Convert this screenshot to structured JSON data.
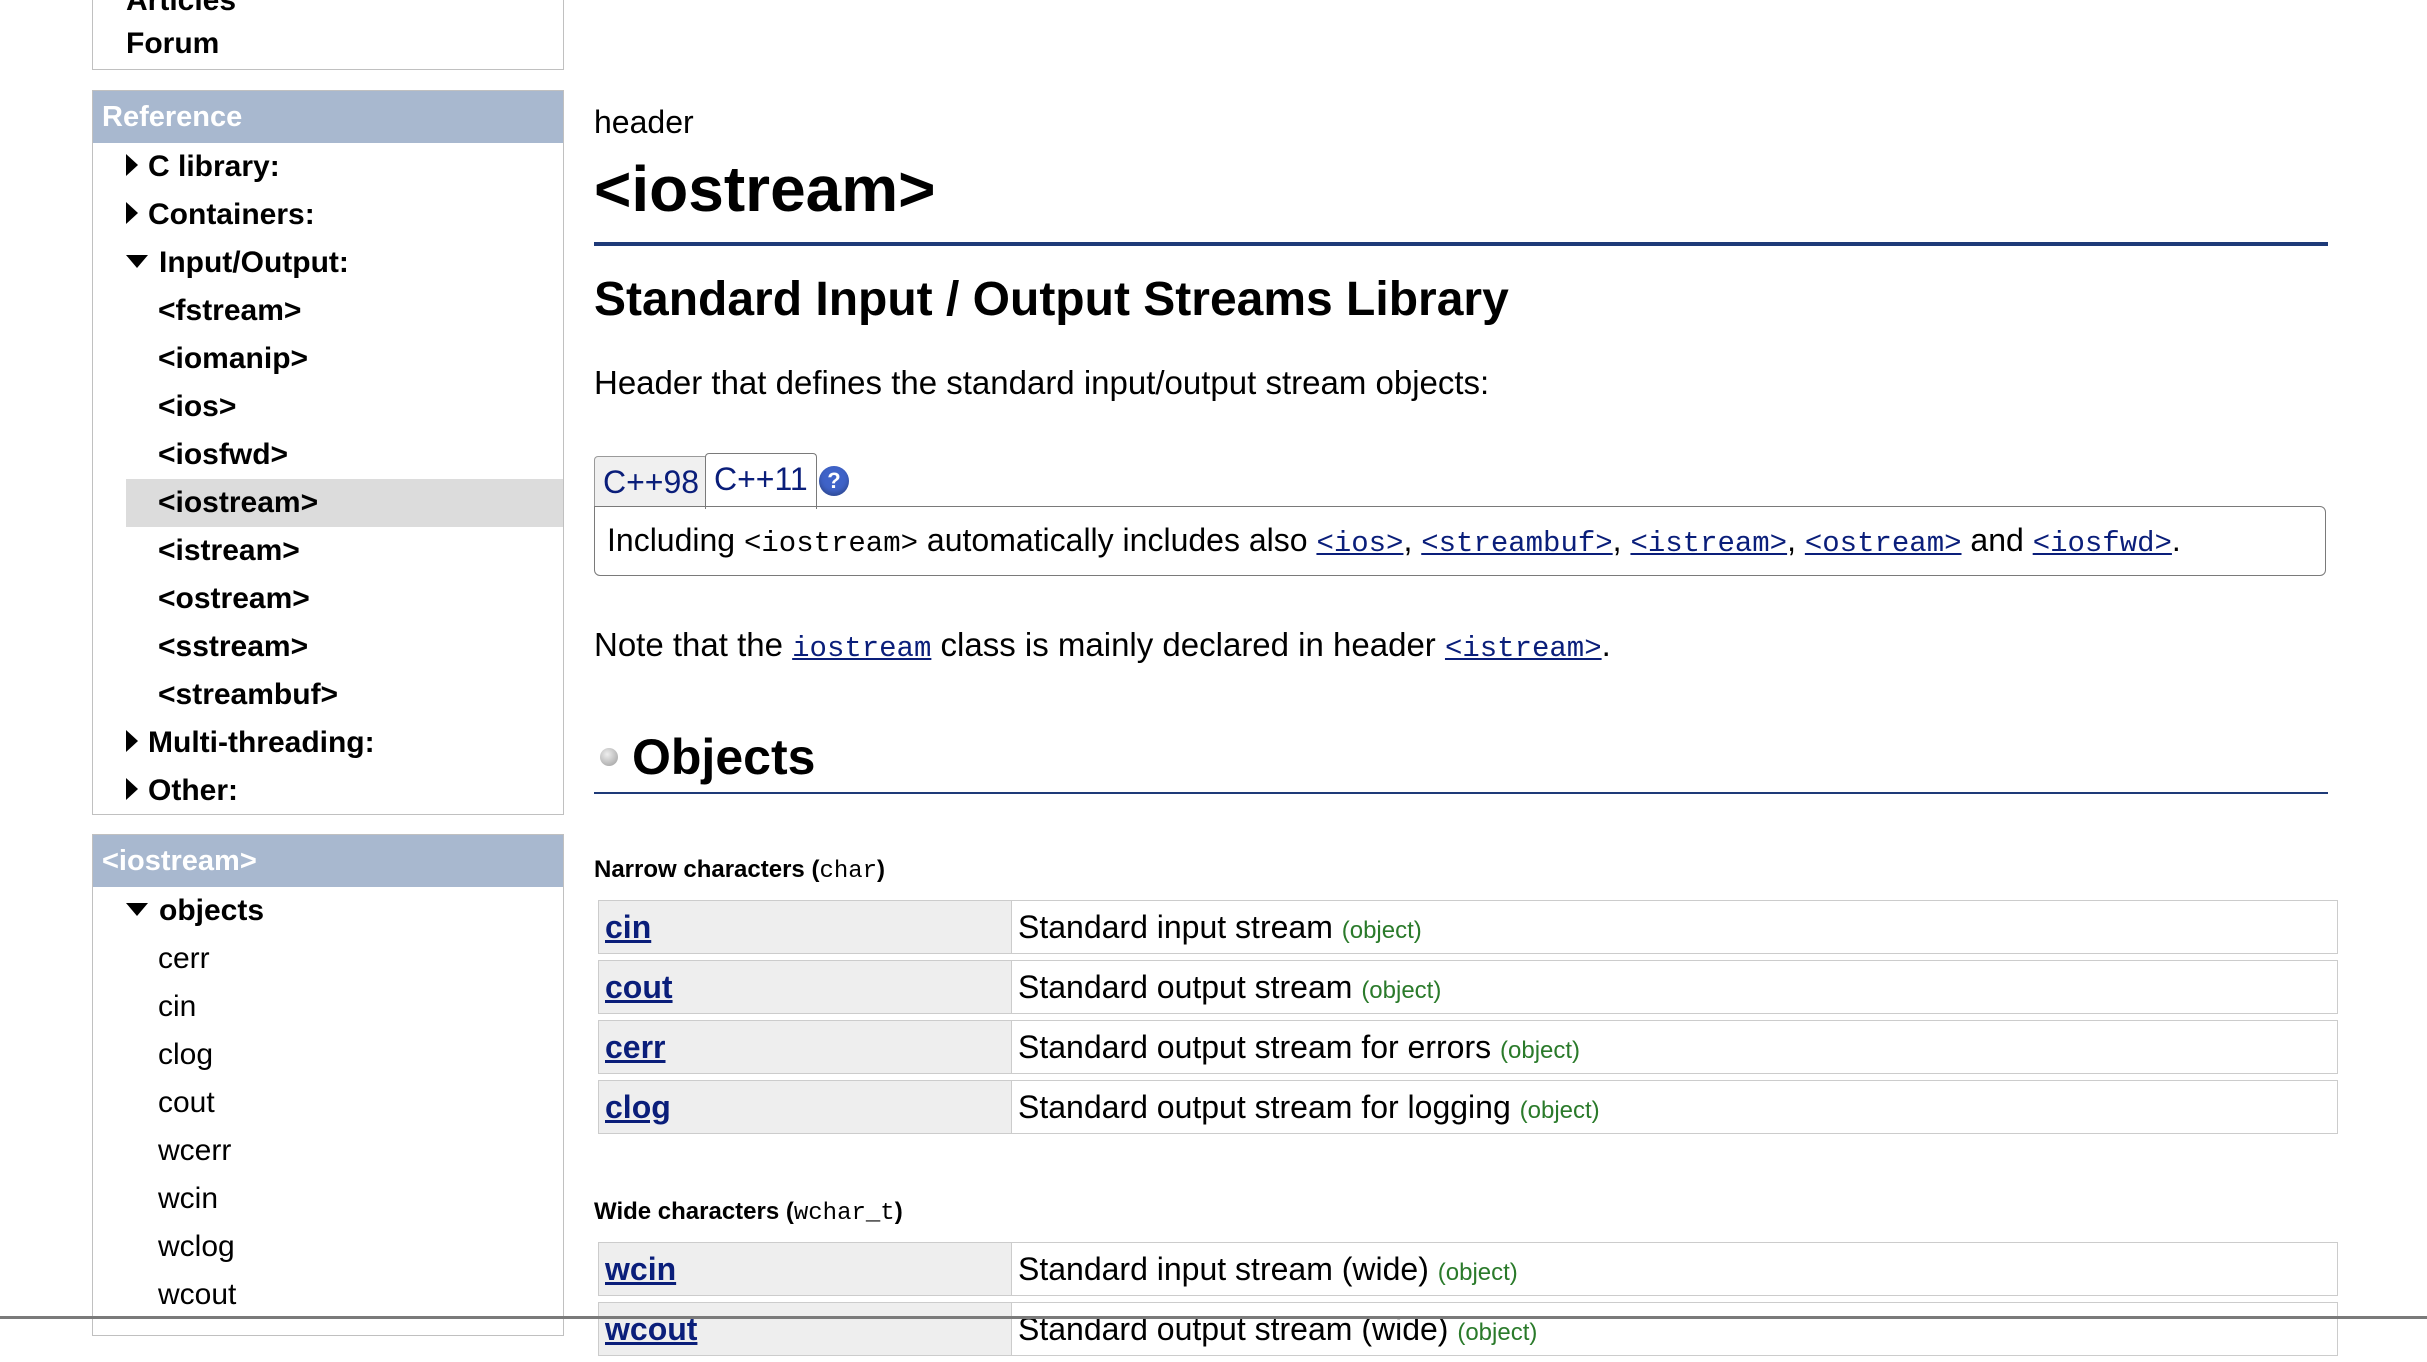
{
  "sidebar": {
    "top_box": {
      "items": [
        "Articles",
        "Forum"
      ]
    },
    "reference": {
      "heading": "Reference",
      "c_library": "C library:",
      "containers": "Containers:",
      "input_output": "Input/Output:",
      "io_items": [
        "<fstream>",
        "<iomanip>",
        "<ios>",
        "<iosfwd>",
        "<iostream>",
        "<istream>",
        "<ostream>",
        "<sstream>",
        "<streambuf>"
      ],
      "selected": "<iostream>",
      "multithreading": "Multi-threading:",
      "other": "Other:"
    },
    "iostream": {
      "heading": "<iostream>",
      "objects_label": "objects",
      "objects": [
        "cerr",
        "cin",
        "clog",
        "cout",
        "wcerr",
        "wcin",
        "wclog",
        "wcout"
      ]
    }
  },
  "main": {
    "kind": "header",
    "title": "<iostream>",
    "subtitle": "Standard Input / Output Streams Library",
    "description": "Header that defines the standard input/output stream objects:",
    "tabs": [
      "C++98",
      "C++11"
    ],
    "active_tab": "C++11",
    "help_icon": "?",
    "version_note": {
      "prefix": "Including ",
      "code": "<iostream>",
      "middle": " automatically includes also ",
      "links": [
        "<ios>",
        "<streambuf>",
        "<istream>",
        "<ostream>"
      ],
      "and": " and ",
      "last_link": "<iosfwd>",
      "end": "."
    },
    "note": {
      "prefix": "Note that the ",
      "link1": "iostream",
      "middle": " class is mainly declared in header ",
      "link2": "<istream>",
      "end": "."
    },
    "objects_heading": "Objects",
    "narrow": {
      "label": "Narrow characters (",
      "type": "char",
      "close": ")",
      "rows": [
        {
          "name": "cin",
          "desc": "Standard input stream",
          "tag": "(object)"
        },
        {
          "name": "cout",
          "desc": "Standard output stream",
          "tag": "(object)"
        },
        {
          "name": "cerr",
          "desc": "Standard output stream for errors",
          "tag": "(object)"
        },
        {
          "name": "clog",
          "desc": "Standard output stream for logging",
          "tag": "(object)"
        }
      ]
    },
    "wide": {
      "label": "Wide characters (",
      "type": "wchar_t",
      "close": ")",
      "rows": [
        {
          "name": "wcin",
          "desc": "Standard input stream (wide)",
          "tag": "(object)"
        },
        {
          "name": "wcout",
          "desc": "Standard output stream (wide)",
          "tag": "(object)"
        }
      ]
    }
  }
}
